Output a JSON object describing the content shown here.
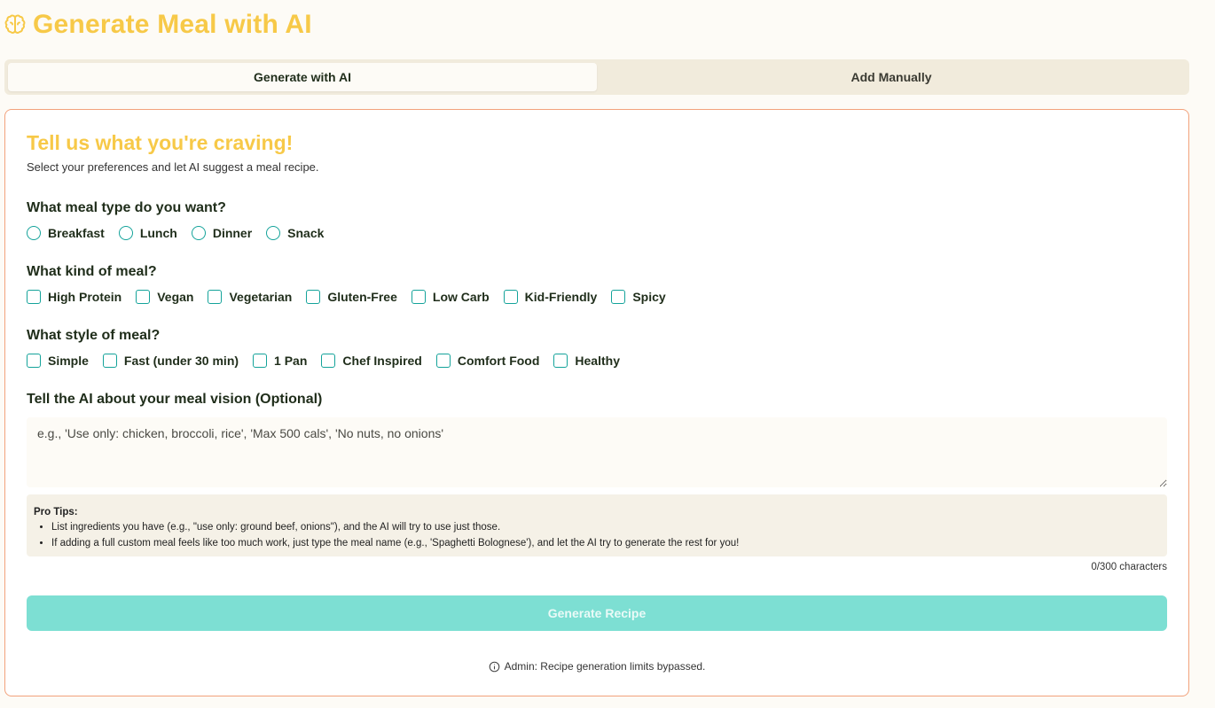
{
  "header": {
    "title": "Generate Meal with AI",
    "icon": "brain-icon",
    "accent_color": "#f7c948"
  },
  "tabs": [
    {
      "label": "Generate with AI",
      "active": true
    },
    {
      "label": "Add Manually",
      "active": false
    }
  ],
  "card": {
    "title": "Tell us what you're craving!",
    "subtitle": "Select your preferences and let AI suggest a meal recipe.",
    "meal_type": {
      "label": "What meal type do you want?",
      "options": [
        "Breakfast",
        "Lunch",
        "Dinner",
        "Snack"
      ]
    },
    "meal_kind": {
      "label": "What kind of meal?",
      "options": [
        "High Protein",
        "Vegan",
        "Vegetarian",
        "Gluten-Free",
        "Low Carb",
        "Kid-Friendly",
        "Spicy"
      ]
    },
    "meal_style": {
      "label": "What style of meal?",
      "options": [
        "Simple",
        "Fast (under 30 min)",
        "1 Pan",
        "Chef Inspired",
        "Comfort Food",
        "Healthy"
      ]
    },
    "vision": {
      "label": "Tell the AI about your meal vision (Optional)",
      "placeholder": "e.g., 'Use only: chicken, broccoli, rice', 'Max 500 cals', 'No nuts, no onions'",
      "value": ""
    },
    "tips": {
      "title": "Pro Tips:",
      "items": [
        "List ingredients you have (e.g., \"use only: ground beef, onions\"), and the AI will try to use just those.",
        "If adding a full custom meal feels like too much work, just type the meal name (e.g., 'Spaghetti Bolognese'), and let the AI try to generate the rest for you!"
      ]
    },
    "char_count": "0/300 characters",
    "generate_label": "Generate Recipe",
    "admin_note": "Admin: Recipe generation limits bypassed."
  },
  "colors": {
    "control_border": "#14a39a",
    "button_bg": "#7ddfd3",
    "card_border": "#f2a27c"
  }
}
